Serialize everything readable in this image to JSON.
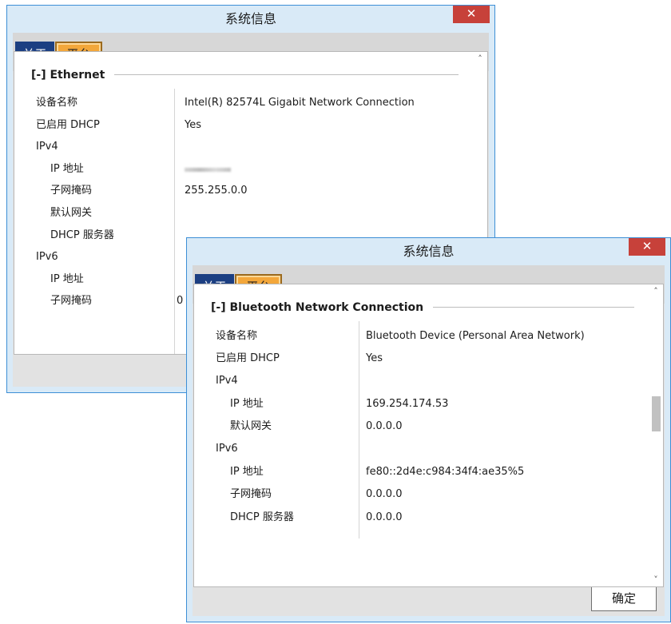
{
  "window_back": {
    "title": "系统信息",
    "close_glyph": "✕",
    "tabs": [
      {
        "label": "关于"
      },
      {
        "label": "平台"
      }
    ],
    "section_title": "[-] Ethernet",
    "rows": [
      {
        "label": "设备名称",
        "value": "Intel(R) 82574L Gigabit Network Connection"
      },
      {
        "label": "已启用 DHCP",
        "value": "Yes"
      },
      {
        "label": "IPv4",
        "value": ""
      },
      {
        "label": "IP 地址",
        "value": "",
        "blurred": true
      },
      {
        "label": "子网掩码",
        "value": "255.255.0.0"
      },
      {
        "label": "默认网关",
        "value": ""
      },
      {
        "label": "DHCP 服务器",
        "value": ""
      },
      {
        "label": "IPv6",
        "value": ""
      },
      {
        "label": "IP 地址",
        "value": ""
      },
      {
        "label": "子网掩码",
        "value": "0"
      }
    ],
    "scroll_up_icon": "˄"
  },
  "window_front": {
    "title": "系统信息",
    "close_glyph": "✕",
    "tabs": [
      {
        "label": "关于"
      },
      {
        "label": "平台"
      }
    ],
    "section_title": "[-] Bluetooth Network Connection",
    "rows": [
      {
        "label": "设备名称",
        "value": "Bluetooth Device (Personal Area Network)"
      },
      {
        "label": "已启用 DHCP",
        "value": "Yes"
      },
      {
        "label": "IPv4",
        "value": ""
      },
      {
        "label": "IP 地址",
        "value": "169.254.174.53"
      },
      {
        "label": "默认网关",
        "value": "0.0.0.0"
      },
      {
        "label": "IPv6",
        "value": ""
      },
      {
        "label": "IP 地址",
        "value": "fe80::2d4e:c984:34f4:ae35%5"
      },
      {
        "label": "子网掩码",
        "value": "0.0.0.0"
      },
      {
        "label": "DHCP 服务器",
        "value": "0.0.0.0"
      }
    ],
    "scroll_up_icon": "˄",
    "scroll_down_icon": "˅",
    "ok_label": "确定"
  }
}
